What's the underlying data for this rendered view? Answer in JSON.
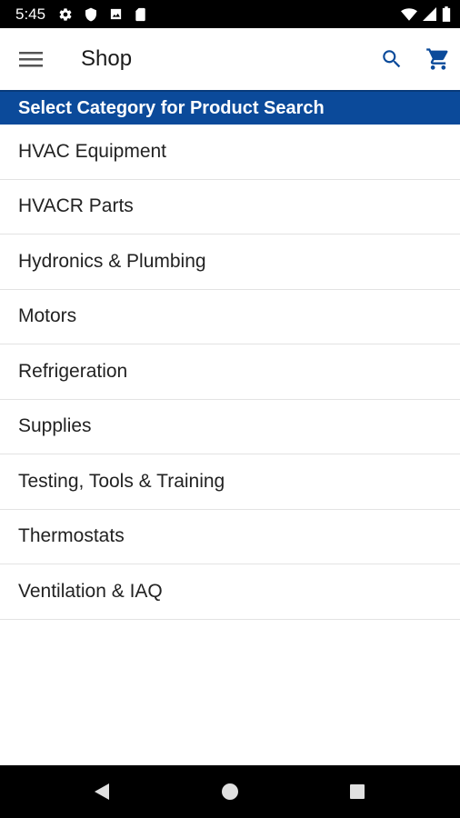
{
  "status_bar": {
    "time": "5:45",
    "left_icons": [
      "gear-icon",
      "shield-icon",
      "photo-icon",
      "sd-card-icon"
    ],
    "right_icons": [
      "wifi-icon",
      "signal-icon",
      "battery-icon"
    ]
  },
  "app_bar": {
    "title": "Shop",
    "menu_icon": "menu-icon",
    "search_icon": "search-icon",
    "cart_icon": "cart-icon"
  },
  "category_header": {
    "text": "Select Category for Product Search"
  },
  "categories": [
    {
      "label": "HVAC Equipment"
    },
    {
      "label": "HVACR Parts"
    },
    {
      "label": "Hydronics & Plumbing"
    },
    {
      "label": "Motors"
    },
    {
      "label": "Refrigeration"
    },
    {
      "label": "Supplies"
    },
    {
      "label": "Testing, Tools & Training"
    },
    {
      "label": "Thermostats"
    },
    {
      "label": "Ventilation & IAQ"
    }
  ],
  "nav_bar": {
    "buttons": [
      "back-icon",
      "home-icon",
      "recents-icon"
    ]
  },
  "colors": {
    "accent": "#0b4a9a",
    "icon_blue": "#0b4a9a",
    "status_bar_bg": "#000000",
    "divider": "#e3e3e3"
  }
}
